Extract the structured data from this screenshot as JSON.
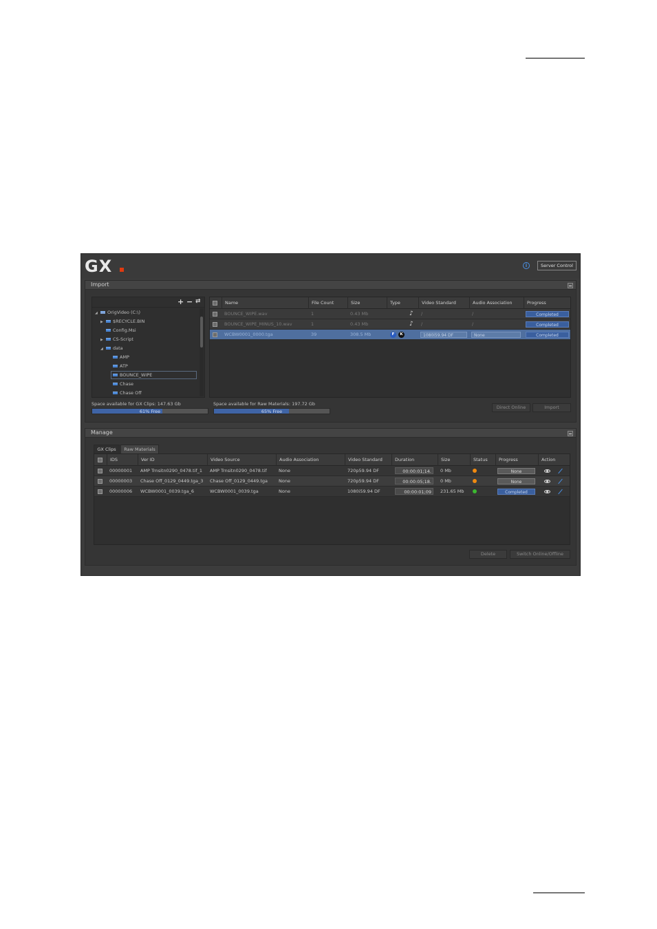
{
  "app": {
    "logo": "GX",
    "server_control": "Server Control",
    "info_icon": "info-icon"
  },
  "import_panel": {
    "title": "Import",
    "tree": {
      "root": "OrigVideo  (C:\\)",
      "items": [
        {
          "label": "$RECYCLE.BIN"
        },
        {
          "label": "Config.Msi"
        },
        {
          "label": "CS-Script"
        },
        {
          "label": "data"
        },
        {
          "label": "AMP"
        },
        {
          "label": "ATP"
        },
        {
          "label": "BOUNCE_WIPE"
        },
        {
          "label": "Chase"
        },
        {
          "label": "Chase Off"
        }
      ]
    },
    "columns": [
      "Name",
      "File Count",
      "Size",
      "Type",
      "Video Standard",
      "Audio Association",
      "Progress"
    ],
    "rows": [
      {
        "name": "BOUNCE_WIPE.wav",
        "file_count": "1",
        "size": "0.43 Mb",
        "video_standard": "/",
        "audio_association": "/",
        "progress": "Completed"
      },
      {
        "name": "BOUNCE_WIPE_MINUS_10.wav",
        "file_count": "1",
        "size": "0.43 Mb",
        "video_standard": "/",
        "audio_association": "/",
        "progress": "Completed"
      },
      {
        "name": "WCBW0001_0000.tga",
        "file_count": "39",
        "size": "308.5 Mb",
        "video_standard": "1080i59.94 DF",
        "audio_association": "None",
        "progress": "Completed"
      }
    ],
    "space_gx_label": "Space available for GX Clips: 147.63 Gb",
    "space_gx_text": "61% Free",
    "space_gx_free": 0.61,
    "space_raw_label": "Space available for Raw Materials: 197.72 Gb",
    "space_raw_text": "65% Free",
    "space_raw_free": 0.65,
    "direct_online": "Direct Online",
    "import_button": "Import"
  },
  "manage_panel": {
    "title": "Manage",
    "tabs": [
      "GX Clips",
      "Raw Materials"
    ],
    "columns": [
      "IDS",
      "Ver ID",
      "Video Source",
      "Audio Association",
      "Video Standard",
      "Duration",
      "Size",
      "Status",
      "Progress",
      "Action"
    ],
    "rows": [
      {
        "ids": "00000001",
        "ver_id": "AMP Trnsitn0290_0478.tif_1",
        "video_source": "AMP Trnsitn0290_0478.tif",
        "audio_association": "None",
        "video_standard": "720p59.94 DF",
        "duration": "00:00:01;14.",
        "size": "0 Mb",
        "status_color": "#f08a10",
        "progress": "None"
      },
      {
        "ids": "00000003",
        "ver_id": "Chase Off_0129_0449.tga_3",
        "video_source": "Chase Off_0129_0449.tga",
        "audio_association": "None",
        "video_standard": "720p59.94 DF",
        "duration": "00:00:05;18.",
        "size": "0 Mb",
        "status_color": "#f08a10",
        "progress": "None"
      },
      {
        "ids": "00000006",
        "ver_id": "WCBW0001_0039.tga_6",
        "video_source": "WCBW0001_0039.tga",
        "audio_association": "None",
        "video_standard": "1080i59.94 DF",
        "duration": "00:00:01;09",
        "size": "231.65 Mb",
        "status_color": "#3cb830",
        "progress": "Completed"
      }
    ],
    "delete_button": "Delete",
    "switch_button": "Switch Online/Offline"
  }
}
